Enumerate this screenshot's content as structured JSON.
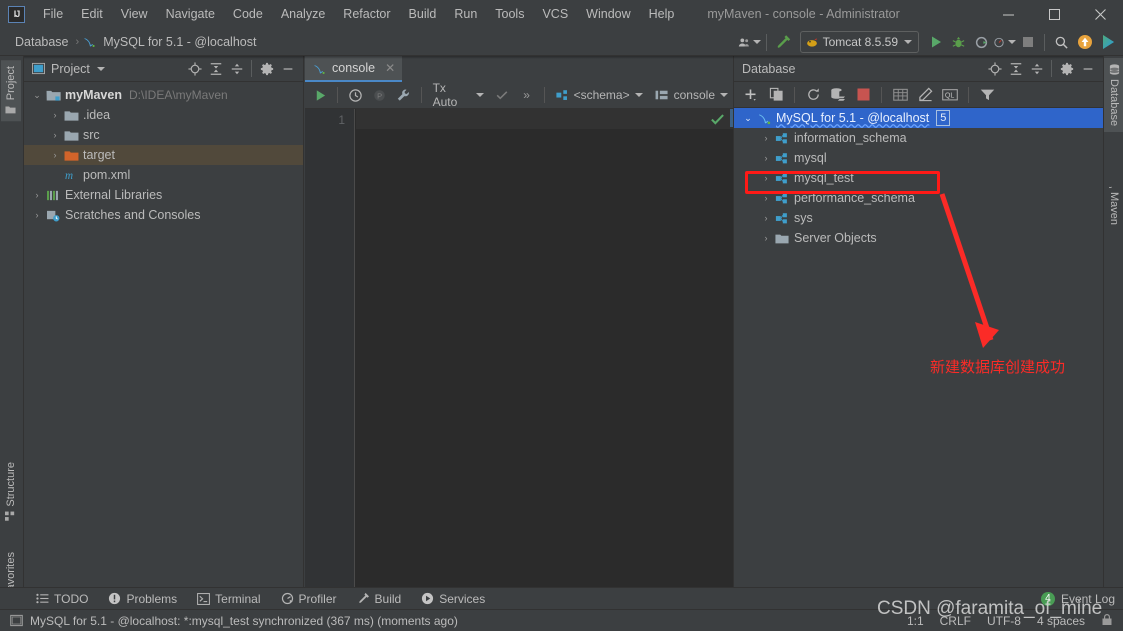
{
  "window": {
    "title": "myMaven - console - Administrator",
    "logo_text": "IJ",
    "minimize": "—",
    "maximize": "☐",
    "close": "✕"
  },
  "menu": {
    "items": [
      {
        "label": "File"
      },
      {
        "label": "Edit"
      },
      {
        "label": "View"
      },
      {
        "label": "Navigate"
      },
      {
        "label": "Code"
      },
      {
        "label": "Analyze"
      },
      {
        "label": "Refactor"
      },
      {
        "label": "Build"
      },
      {
        "label": "Run"
      },
      {
        "label": "Tools"
      },
      {
        "label": "VCS"
      },
      {
        "label": "Window"
      },
      {
        "label": "Help"
      }
    ]
  },
  "navbar": {
    "breadcrumb": [
      "Database",
      "MySQL for 5.1 - @localhost"
    ],
    "separator": "›",
    "run_config": "Tomcat 8.5.59"
  },
  "stripes": {
    "left": [
      {
        "label": "Project",
        "active": true
      },
      {
        "label": "Structure",
        "active": false
      },
      {
        "label": "Favorites",
        "active": false
      }
    ],
    "right": [
      {
        "label": "Database",
        "active": true
      },
      {
        "label": "Maven",
        "active": false
      }
    ]
  },
  "project_panel": {
    "title": "Project",
    "tree": [
      {
        "label": "myMaven",
        "sub": "D:\\IDEA\\myMaven",
        "arrow": "⌄",
        "indent": 0,
        "icon": "module-icon",
        "bold": true,
        "selected": false
      },
      {
        "label": ".idea",
        "sub": "",
        "arrow": "›",
        "indent": 1,
        "icon": "folder-icon",
        "bold": false,
        "selected": false
      },
      {
        "label": "src",
        "sub": "",
        "arrow": "›",
        "indent": 1,
        "icon": "folder-icon",
        "bold": false,
        "selected": false
      },
      {
        "label": "target",
        "sub": "",
        "arrow": "›",
        "indent": 1,
        "icon": "folder-orange-icon",
        "bold": false,
        "selected": true
      },
      {
        "label": "pom.xml",
        "sub": "",
        "arrow": "",
        "indent": 1,
        "icon": "maven-file-icon",
        "bold": false,
        "selected": false
      },
      {
        "label": "External Libraries",
        "sub": "",
        "arrow": "›",
        "indent": 0,
        "icon": "libraries-icon",
        "bold": false,
        "selected": false
      },
      {
        "label": "Scratches and Consoles",
        "sub": "",
        "arrow": "›",
        "indent": 0,
        "icon": "scratches-icon",
        "bold": false,
        "selected": false
      }
    ]
  },
  "editor": {
    "tab_label": "console",
    "tab_close": "✕",
    "toolbar": {
      "tx_mode": "Tx Auto",
      "expand": "»",
      "schema": "<schema>",
      "session": "console"
    },
    "line_number": "1",
    "content": ""
  },
  "db_panel": {
    "title": "Database",
    "tree": [
      {
        "label": "MySQL for 5.1 - @localhost",
        "arrow": "⌄",
        "indent": 0,
        "icon": "mysql-icon",
        "selected": true,
        "badge": "5"
      },
      {
        "label": "information_schema",
        "arrow": "›",
        "indent": 1,
        "icon": "schema-icon",
        "selected": false,
        "badge": ""
      },
      {
        "label": "mysql",
        "arrow": "›",
        "indent": 1,
        "icon": "schema-icon",
        "selected": false,
        "badge": ""
      },
      {
        "label": "mysql_test",
        "arrow": "›",
        "indent": 1,
        "icon": "schema-icon",
        "selected": false,
        "badge": ""
      },
      {
        "label": "performance_schema",
        "arrow": "›",
        "indent": 1,
        "icon": "schema-icon",
        "selected": false,
        "badge": ""
      },
      {
        "label": "sys",
        "arrow": "›",
        "indent": 1,
        "icon": "schema-icon",
        "selected": false,
        "badge": ""
      },
      {
        "label": "Server Objects",
        "arrow": "›",
        "indent": 1,
        "icon": "folder-icon",
        "selected": false,
        "badge": ""
      }
    ]
  },
  "annotation": {
    "text": "新建数据库创建成功",
    "color": "#fb2b27",
    "highlight_target": "mysql_test"
  },
  "toolwindow_bar": {
    "items": [
      {
        "label": "TODO",
        "icon": "todo-icon"
      },
      {
        "label": "Problems",
        "icon": "problems-icon"
      },
      {
        "label": "Terminal",
        "icon": "terminal-icon"
      },
      {
        "label": "Profiler",
        "icon": "profiler-icon"
      },
      {
        "label": "Build",
        "icon": "build-icon"
      },
      {
        "label": "Services",
        "icon": "services-icon"
      }
    ],
    "event_log": "Event Log",
    "event_count": "4"
  },
  "statusbar": {
    "message": "MySQL for 5.1 - @localhost: *:mysql_test synchronized (367 ms) (moments ago)",
    "caret": "1:1",
    "line_sep": "CRLF",
    "encoding": "UTF-8",
    "indent": "4 spaces"
  },
  "watermark": {
    "text": "CSDN @faramita_of_mine"
  },
  "colors": {
    "accent_blue": "#2f65ca",
    "panel_bg": "#3c3f41",
    "editor_bg": "#2b2b2b",
    "selection_inactive": "#51493b",
    "annotation_red": "#fb2b27",
    "run_green": "#499c54"
  }
}
